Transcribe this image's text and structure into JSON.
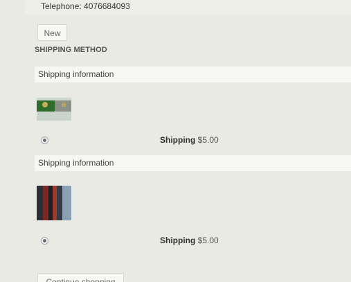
{
  "contact": {
    "telephone": "Telephone: 4076684093"
  },
  "address_actions": {
    "new_label": "New"
  },
  "shipping": {
    "section_title": "SHIPPING METHOD",
    "groups": [
      {
        "header": "Shipping information",
        "thumbnail": "product-thumbnail-green-box",
        "method_label": "Shipping",
        "price": "$5.00",
        "selected": true
      },
      {
        "header": "Shipping information",
        "thumbnail": "product-thumbnail-red-black-item",
        "method_label": "Shipping",
        "price": "$5.00",
        "selected": true
      }
    ]
  },
  "footer": {
    "continue_label": "Continue shopping"
  }
}
